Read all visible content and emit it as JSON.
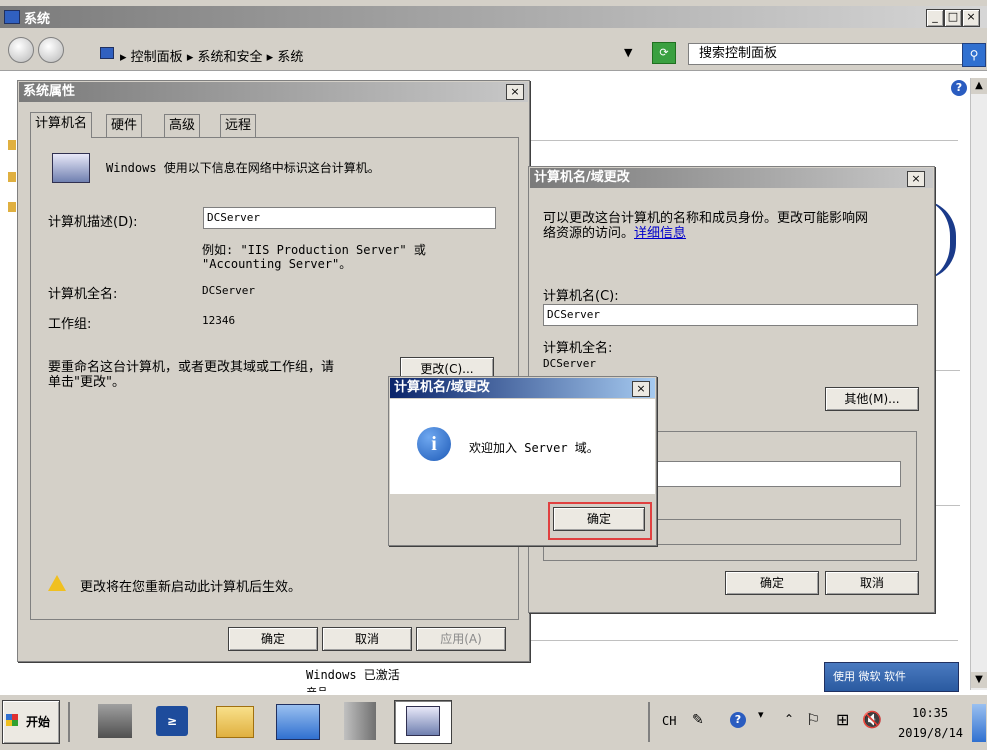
{
  "window": {
    "title": "系统",
    "min": "_",
    "max": "□",
    "close": "×"
  },
  "breadcrumb": {
    "items": [
      "控制面板",
      "系统和安全",
      "系统"
    ]
  },
  "search": {
    "placeholder": "搜索控制面板"
  },
  "bg": {
    "activation": "Windows 已激活",
    "partial": "产品",
    "genuine_badge": "使用 微软 软件"
  },
  "sysprops": {
    "title": "系统属性",
    "tabs": [
      "计算机名",
      "硬件",
      "高级",
      "远程"
    ],
    "intro": "Windows 使用以下信息在网络中标识这台计算机。",
    "desc_label": "计算机描述(D):",
    "desc_value": "DCServer",
    "example_line1": "例如: \"IIS Production Server\" 或",
    "example_line2": "\"Accounting Server\"。",
    "fullname_label": "计算机全名:",
    "fullname_value": "DCServer",
    "workgroup_label": "工作组:",
    "workgroup_value": "12346",
    "rename_line1": "要重命名这台计算机，或者更改其域或工作组，请",
    "rename_line2": "单击\"更改\"。",
    "change_button": "更改(C)...",
    "warning": "更改将在您重新启动此计算机后生效。",
    "ok": "确定",
    "cancel": "取消",
    "apply": "应用(A)"
  },
  "namechange": {
    "title": "计算机名/域更改",
    "intro_line1": "可以更改这台计算机的名称和成员身份。更改可能影响网",
    "intro_line2": "络资源的访问。",
    "details_link": "详细信息",
    "name_label": "计算机名(C):",
    "name_value": "DCServer",
    "fullname_label": "计算机全名:",
    "fullname_value": "DCServer",
    "more_button": "其他(M)...",
    "ok": "确定",
    "cancel": "取消"
  },
  "msgbox": {
    "title": "计算机名/域更改",
    "message": "欢迎加入 Server 域。",
    "ok": "确定"
  },
  "taskbar": {
    "start": "开始",
    "lang": "CH",
    "time": "10:35",
    "date": "2019/8/14"
  },
  "colors": {
    "titlebar_active": "#0a246a",
    "titlebar_inactive": "#808080",
    "info_icon": "#1e5bb8",
    "highlight_border": "#e04040"
  }
}
